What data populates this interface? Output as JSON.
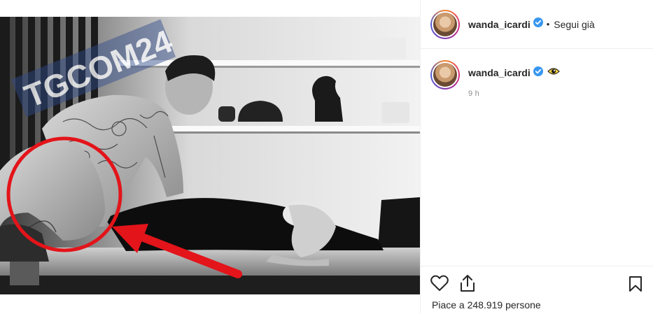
{
  "watermark": {
    "text": "TGCOM24"
  },
  "post": {
    "username": "wanda_icardi",
    "separator": "•",
    "follow_status": "Segui già",
    "caption_emoji": "eye-emoji",
    "timestamp": "9 h",
    "likes_text": "Piace a 248.919 persone"
  },
  "icons": {
    "verified": "verified-badge-icon",
    "like": "heart-icon",
    "share": "share-icon",
    "save": "bookmark-icon"
  },
  "colors": {
    "verified_blue": "#3897f0",
    "annotation_red": "#e3141a",
    "watermark_blue": "#2f4a8a"
  }
}
